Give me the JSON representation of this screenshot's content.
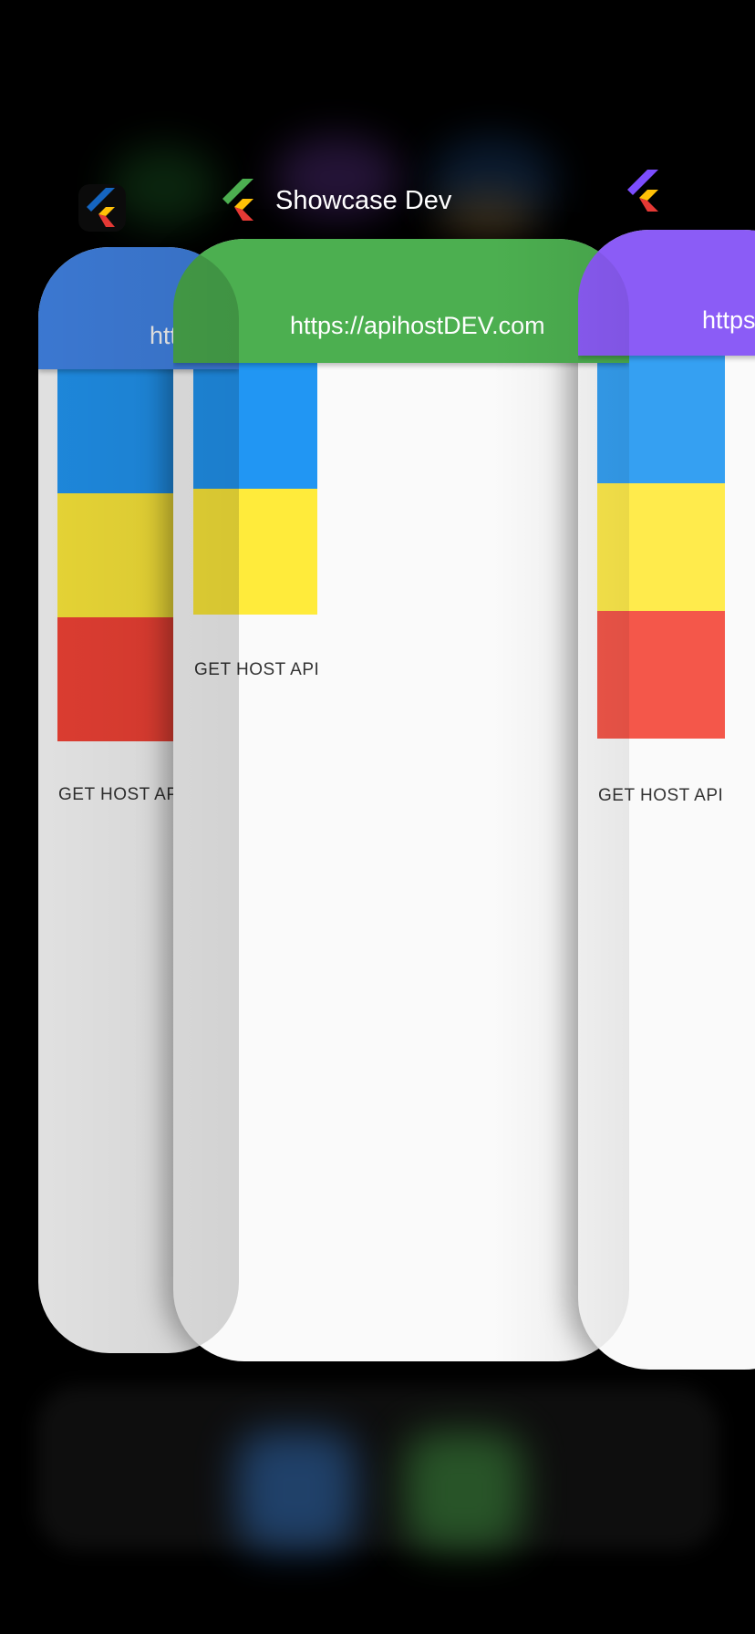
{
  "app_switcher": {
    "apps": [
      {
        "id": "left",
        "label": "",
        "icon": "flutter-blue-icon",
        "accent": "#4285E8",
        "appbar_title": "https://apihostDEV.com",
        "button_label": "GET HOST API",
        "blocks": [
          "#2196F3",
          "#FFEB3B",
          "#F44336"
        ]
      },
      {
        "id": "center",
        "label": "Showcase Dev",
        "icon": "flutter-green-icon",
        "accent": "#4CAF50",
        "appbar_title": "https://apihostDEV.com",
        "button_label": "GET HOST API",
        "blocks": [
          "#2196F3",
          "#FFEB3B"
        ]
      },
      {
        "id": "right",
        "label": "",
        "icon": "flutter-purple-icon",
        "accent": "#8B5CF6",
        "appbar_title": "https://apihostDEV.com",
        "button_label": "GET HOST API",
        "blocks": [
          "#35A0F2",
          "#FFEB4C",
          "#F4574A"
        ]
      }
    ]
  },
  "dock": {
    "icons": [
      "blurred-blue-app-icon",
      "blurred-green-app-icon"
    ],
    "colors": [
      "#2F6BB5",
      "#3E8E3E"
    ]
  }
}
